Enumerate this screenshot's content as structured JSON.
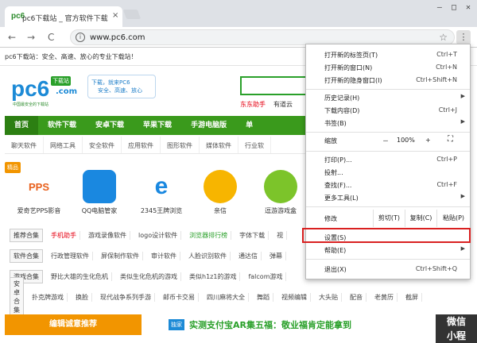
{
  "browser": {
    "tab_title": "pc6下载站 _ 官方软件下载站",
    "tab_favicon": "pc6",
    "tab_close": "×",
    "window_controls": [
      "—",
      "□",
      "✕"
    ],
    "back": "←",
    "forward": "→",
    "reload": "C",
    "info": "i",
    "url": "www.pc6.com",
    "star": "☆",
    "menu_icon": "⋮"
  },
  "page": {
    "notice": "pc6下载站：安全、高速、放心的专业下载站！",
    "logo": {
      "main": "pc6",
      "tag": "下载站",
      "com": ".com",
      "sub": "中国最安全的下载站"
    },
    "slogan": [
      "下载，就来PC6",
      "安全、高速、放心"
    ],
    "search_links": [
      "东东助手",
      "有道云"
    ],
    "main_nav": [
      "首页",
      "软件下载",
      "安卓下载",
      "苹果下载",
      "手游电脑版",
      "单"
    ],
    "sub_nav": [
      "聊天软件",
      "网络工具",
      "安全软件",
      "应用软件",
      "图形软件",
      "媒体软件",
      "行业软"
    ],
    "apps_badge": "精品",
    "apps": [
      {
        "name": "爱奇艺PPS影音",
        "color": "#ffffff"
      },
      {
        "name": "QQ电脑管家",
        "color": "#1a88e0"
      },
      {
        "name": "2345王牌浏览",
        "color": "#ffffff"
      },
      {
        "name": "亲信",
        "color": "#f7b500"
      },
      {
        "name": "逗游游戏盒",
        "color": "#ffffff"
      }
    ],
    "rows": [
      {
        "label": "推荐合集",
        "items": [
          "手机助手",
          "游戏录像软件",
          "logo设计软件",
          "浏览器排行榜",
          "字体下载",
          "视"
        ]
      },
      {
        "label": "软件合集",
        "items": [
          "行政管理软件",
          "屏保制作软件",
          "审计软件",
          "人脸识别软件",
          "通达信",
          "弹幕"
        ]
      },
      {
        "label": "游戏合集",
        "items": [
          "野比大雄的生化危机",
          "类似生化危机的游戏",
          "类似h1z1的游戏",
          "falcom游戏"
        ]
      },
      {
        "label": "安卓合集",
        "items": [
          "扑克牌游戏",
          "换脸",
          "现代战争系列手游",
          "邮币卡交易",
          "四川麻将大全",
          "舞蹈",
          "视频编辑",
          "大头贴",
          "配音",
          "老黄历",
          "截屏"
        ]
      }
    ],
    "editor_bar": "编辑诚意推荐",
    "ad_tag": "独家",
    "ad_text": "实测支付宝AR集五福：敬业福肯定能拿到",
    "wechat": [
      "微信",
      "小程"
    ]
  },
  "menu": {
    "new_tab": {
      "label": "打开新的标签页(T)",
      "shortcut": "Ctrl+T"
    },
    "new_window": {
      "label": "打开新的窗口(N)",
      "shortcut": "Ctrl+N"
    },
    "incognito": {
      "label": "打开新的隐身窗口(I)",
      "shortcut": "Ctrl+Shift+N"
    },
    "history": {
      "label": "历史记录(H)"
    },
    "downloads": {
      "label": "下载内容(D)",
      "shortcut": "Ctrl+J"
    },
    "bookmarks": {
      "label": "书签(B)"
    },
    "zoom": {
      "label": "缩放",
      "minus": "－",
      "value": "100%",
      "plus": "+",
      "fullscreen": "⛶"
    },
    "print": {
      "label": "打印(P)...",
      "shortcut": "Ctrl+P"
    },
    "cast": {
      "label": "投射..."
    },
    "find": {
      "label": "查找(F)...",
      "shortcut": "Ctrl+F"
    },
    "more_tools": {
      "label": "更多工具(L)"
    },
    "edit": {
      "label": "修改",
      "cut": "剪切(T)",
      "copy": "复制(C)",
      "paste": "粘贴(P)"
    },
    "settings": {
      "label": "设置(S)"
    },
    "help": {
      "label": "帮助(E)"
    },
    "exit": {
      "label": "退出(X)",
      "shortcut": "Ctrl+Shift+Q"
    },
    "arrow": "▶"
  }
}
